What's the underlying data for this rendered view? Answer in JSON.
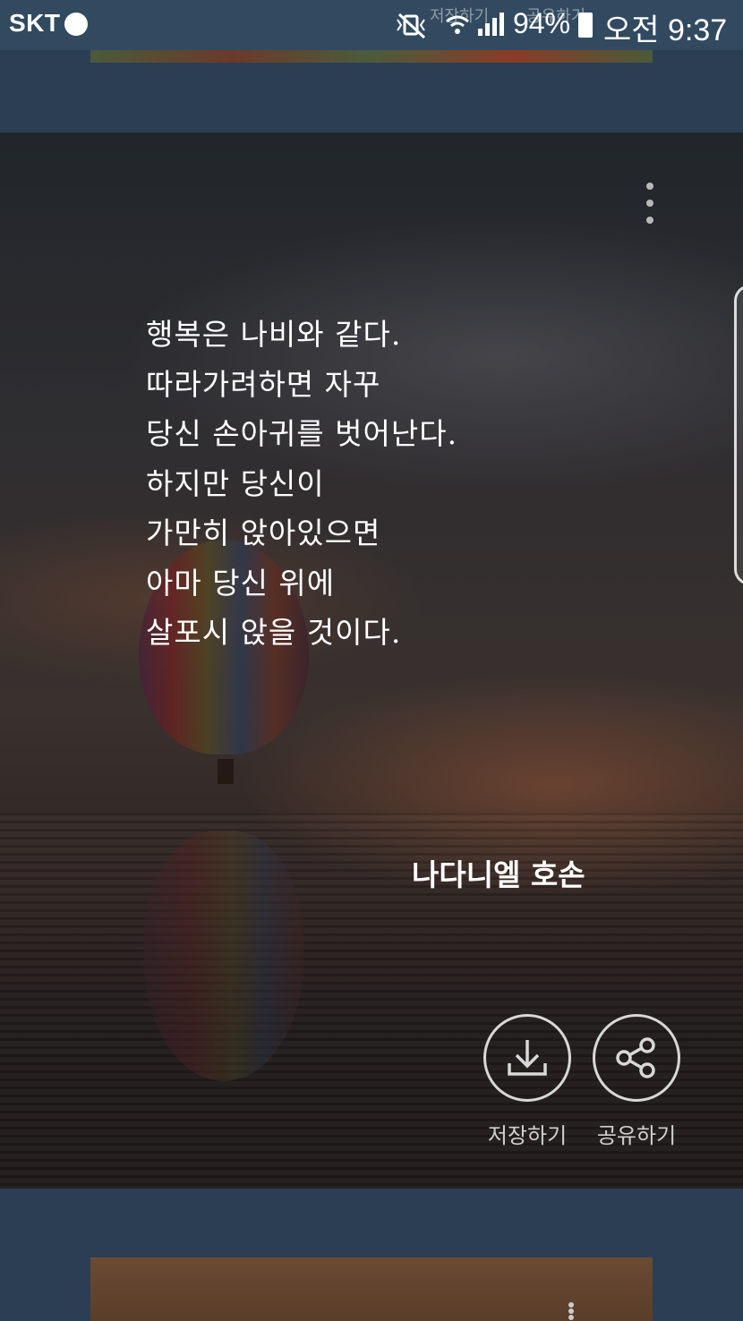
{
  "status_bar": {
    "carrier": "SKT",
    "battery_percent": "94%",
    "time": "오전 9:37",
    "ghost_labels": [
      "저장하기",
      "공유하기"
    ],
    "icons": [
      "notification-dot-icon",
      "vibrate-mute-icon",
      "wifi-icon",
      "signal-icon",
      "battery-icon"
    ]
  },
  "card": {
    "quote_lines": [
      "행복은 나비와 같다.",
      "따라가려하면 자꾸",
      "당신 손아귀를 벗어난다.",
      "하지만 당신이",
      "가만히 앉아있으면",
      "아마 당신 위에",
      "살포시 앉을 것이다."
    ],
    "author": "나다니엘 호손",
    "actions": {
      "save_label": "저장하기",
      "share_label": "공유하기"
    }
  },
  "colors": {
    "page_background": "#2c3e54",
    "status_bar": "#324a60",
    "text": "#ffffff",
    "action_label": "#d0d0d0"
  }
}
